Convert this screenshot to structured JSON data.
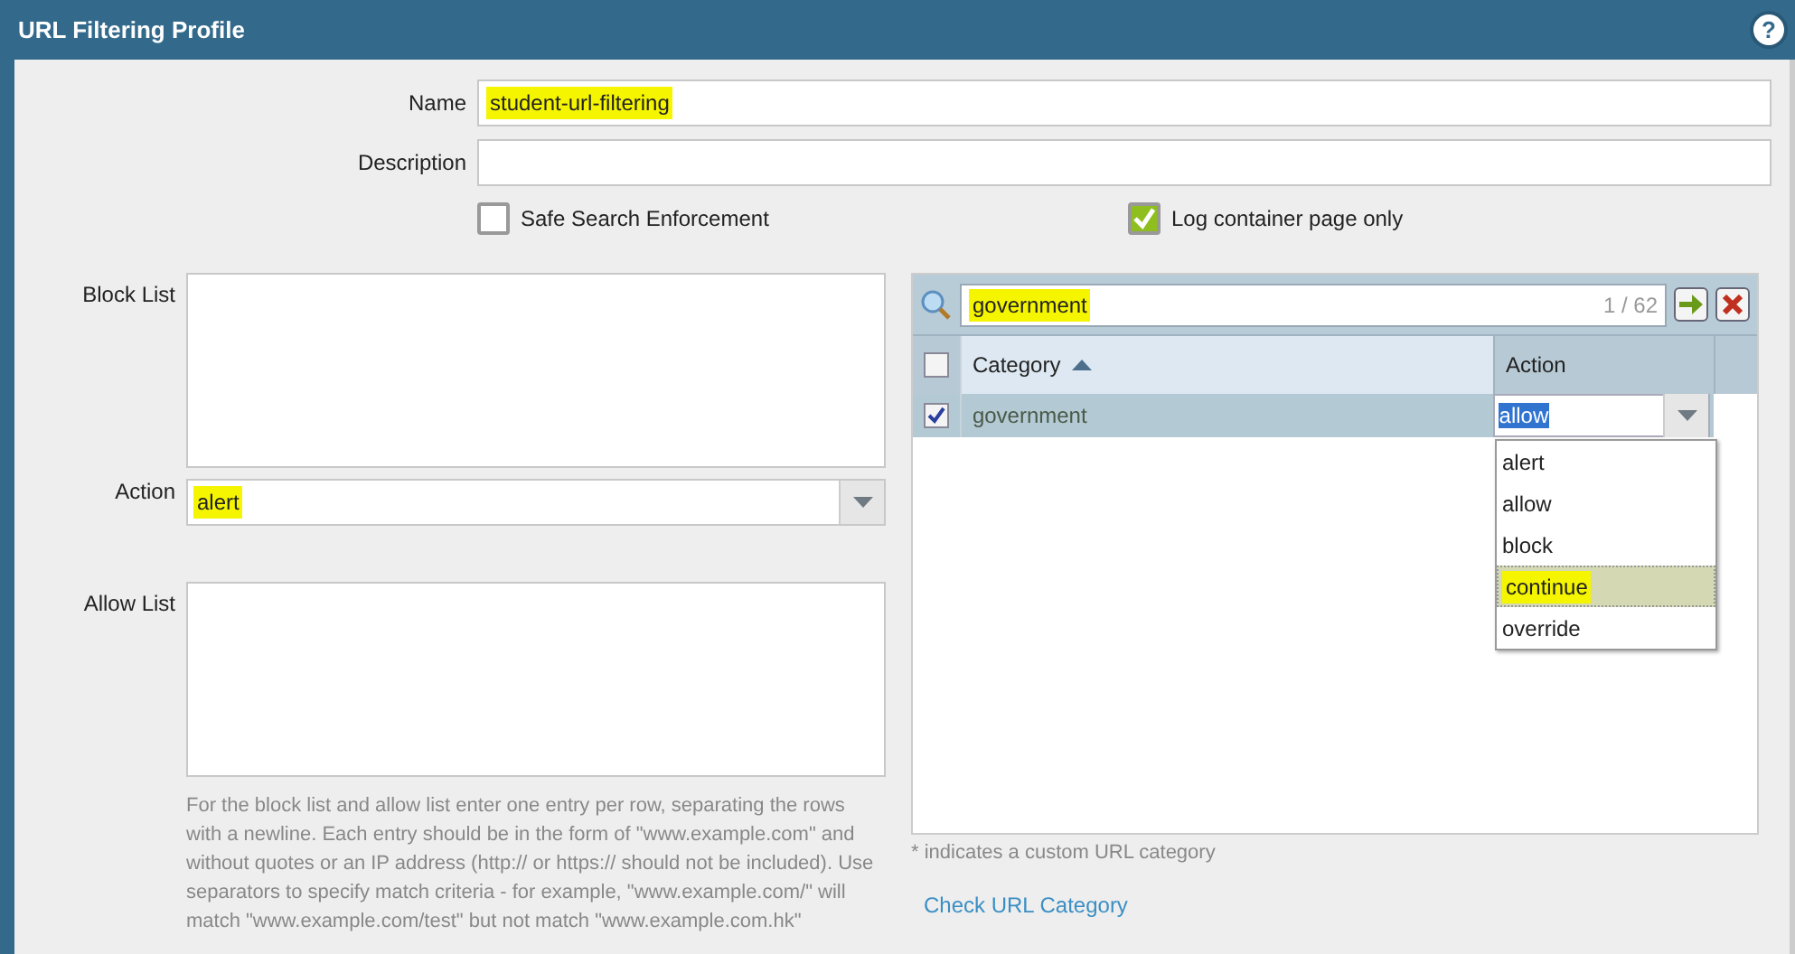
{
  "window": {
    "title": "URL Filtering Profile",
    "help": "?"
  },
  "name": {
    "label": "Name",
    "value": "student-url-filtering",
    "highlighted": true
  },
  "description": {
    "label": "Description"
  },
  "options": [
    {
      "label": "Safe Search Enforcement",
      "checked": false
    },
    {
      "label": "Log container page only",
      "checked": true
    }
  ],
  "block_list": {
    "label": "Block List"
  },
  "action": {
    "label": "Action",
    "value": "alert",
    "highlighted": true
  },
  "allow_list": {
    "label": "Allow List"
  },
  "help_text": "For the block list and allow list enter one entry per row, separating the rows with a newline. Each entry should be in the form of \"www.example.com\" and without quotes or an IP address (http:// or https:// should not be included). Use separators to specify match criteria - for example, \"www.example.com/\" will match \"www.example.com/test\" but not match \"www.example.com.hk\"",
  "categories": {
    "search": {
      "value": "government",
      "count": "1 / 62",
      "highlighted": true
    },
    "header_checked": false,
    "columns": [
      {
        "label": "Category",
        "sorted": true
      },
      {
        "label": "Action",
        "sorted": false
      }
    ],
    "rows": [
      {
        "checked": true,
        "category": "government",
        "action": "allow",
        "text_selected": true
      }
    ],
    "dropdown": [
      {
        "label": "alert",
        "selected": false,
        "highlighted": false
      },
      {
        "label": "allow",
        "selected": false,
        "highlighted": false
      },
      {
        "label": "block",
        "selected": false,
        "highlighted": false
      },
      {
        "label": "continue",
        "selected": true,
        "highlighted": true
      },
      {
        "label": "override",
        "selected": false,
        "highlighted": false
      }
    ],
    "note": "* indicates a custom URL category"
  },
  "link": "Check URL Category"
}
